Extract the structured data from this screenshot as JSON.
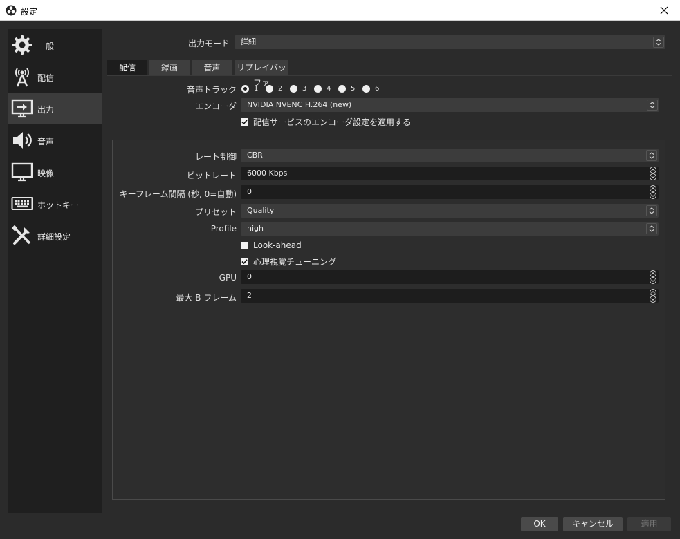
{
  "window": {
    "title": "設定"
  },
  "sidebar": {
    "items": [
      {
        "label": "一般",
        "icon": "gear-icon"
      },
      {
        "label": "配信",
        "icon": "broadcast-antenna-icon"
      },
      {
        "label": "出力",
        "icon": "output-monitor-icon",
        "active": true
      },
      {
        "label": "音声",
        "icon": "speaker-icon"
      },
      {
        "label": "映像",
        "icon": "monitor-icon"
      },
      {
        "label": "ホットキー",
        "icon": "keyboard-icon"
      },
      {
        "label": "詳細設定",
        "icon": "tools-icon"
      }
    ]
  },
  "output_mode": {
    "label": "出力モード",
    "value": "詳細"
  },
  "tabs": [
    {
      "label": "配信",
      "active": true
    },
    {
      "label": "録画"
    },
    {
      "label": "音声"
    },
    {
      "label": "リプレイバッファ"
    }
  ],
  "audio_track": {
    "label": "音声トラック",
    "options": [
      "1",
      "2",
      "3",
      "4",
      "5",
      "6"
    ],
    "selected": "1"
  },
  "encoder": {
    "label": "エンコーダ",
    "value": "NVIDIA NVENC H.264 (new)"
  },
  "apply_service_settings": {
    "label": "配信サービスのエンコーダ設定を適用する",
    "checked": true
  },
  "encoder_settings": {
    "rate_control": {
      "label": "レート制御",
      "value": "CBR"
    },
    "bitrate": {
      "label": "ビットレート",
      "value": "6000 Kbps"
    },
    "keyframe_interval": {
      "label": "キーフレーム間隔 (秒, 0=自動)",
      "value": "0"
    },
    "preset": {
      "label": "プリセット",
      "value": "Quality"
    },
    "profile": {
      "label": "Profile",
      "value": "high"
    },
    "look_ahead": {
      "label": "Look-ahead",
      "checked": false
    },
    "psycho_visual": {
      "label": "心理視覚チューニング",
      "checked": true
    },
    "gpu": {
      "label": "GPU",
      "value": "0"
    },
    "max_b_frames": {
      "label": "最大 B フレーム",
      "value": "2"
    }
  },
  "buttons": {
    "ok": "OK",
    "cancel": "キャンセル",
    "apply": "適用"
  },
  "colors": {
    "background": "#2b2b2b",
    "sidebar": "#1f1f1f",
    "field": "#3c3c3c",
    "spin_field": "#1d1d1d"
  }
}
